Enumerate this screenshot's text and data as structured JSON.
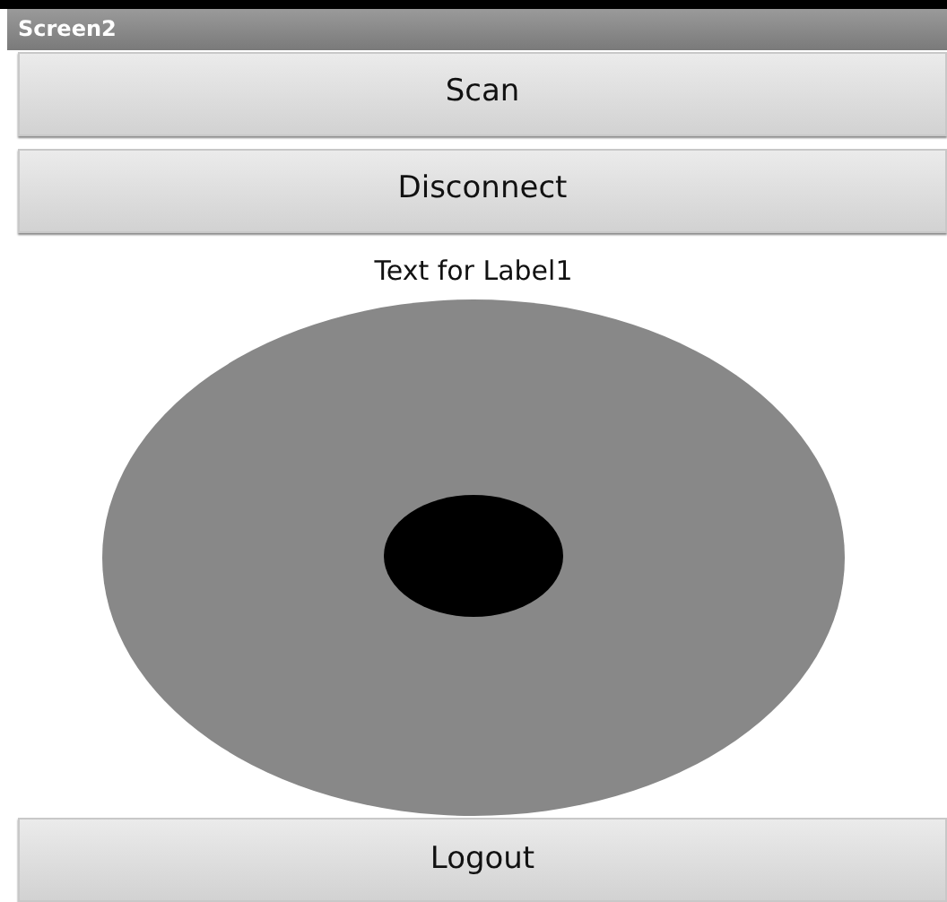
{
  "window": {
    "title": "Screen2"
  },
  "buttons": [
    "Scan",
    "Disconnect"
  ],
  "label": "Text for Label1",
  "bottom_button": "Logout"
}
